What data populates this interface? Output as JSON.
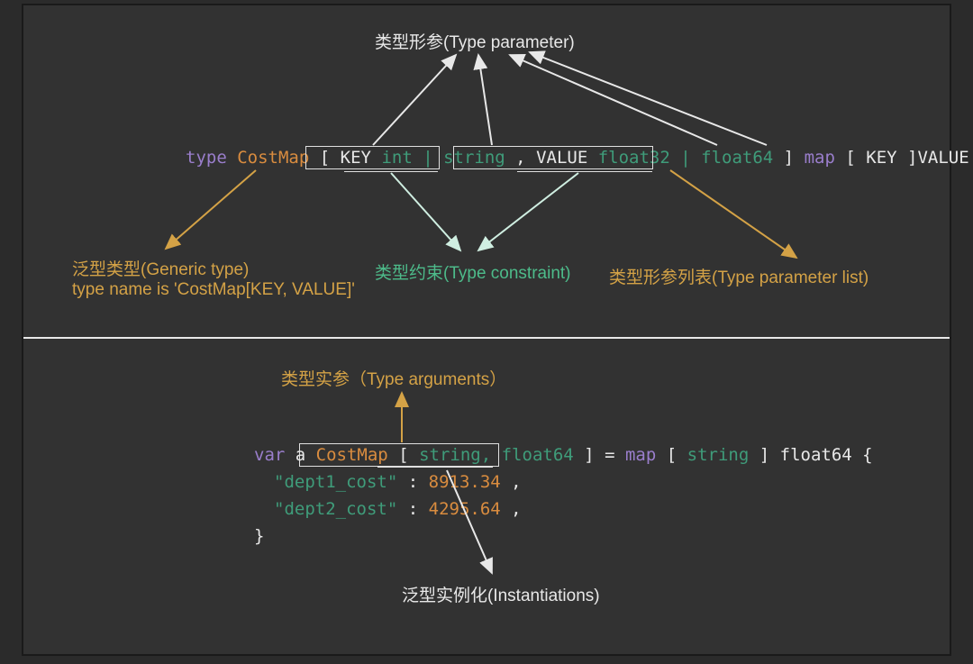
{
  "top": {
    "labels": {
      "type_parameter": "类型形参(Type parameter)",
      "generic_type_l1": "泛型类型(Generic type)",
      "generic_type_l2": "type name is 'CostMap[KEY, VALUE]'",
      "type_constraint": "类型约束(Type constraint)",
      "type_param_list": "类型形参列表(Type parameter list)"
    },
    "code": {
      "type_kw": "type",
      "name": "CostMap",
      "lbracket": "[",
      "key": "KEY",
      "key_constraint": "int | string",
      "comma1": ",",
      "value": "  VALUE",
      "value_constraint": "float32 | float64",
      "rbracket": "]",
      "map": " map",
      "map_rest_1": "[",
      "map_rest_key": "KEY",
      "map_rest_2": "]VALUE"
    }
  },
  "bottom": {
    "labels": {
      "type_arguments": "类型实参（Type arguments）",
      "instantiations": "泛型实例化(Instantiations)"
    },
    "code": {
      "var_kw": "var",
      "a": " a ",
      "costmap": "CostMap",
      "lbracket": "[",
      "args": "string, float64",
      "rbracket": "]",
      "eq": " = ",
      "map_kw": "map",
      "map_lb": "[",
      "map_key": "string",
      "map_rb": "]",
      "map_val": "float64",
      "lbrace": "{",
      "k1": "\"dept1_cost\"",
      "v1": "8913.34",
      "k2": "\"dept2_cost\"",
      "v2": "4295.64",
      "colon": ": ",
      "comma": ",",
      "rbrace": "}"
    }
  }
}
